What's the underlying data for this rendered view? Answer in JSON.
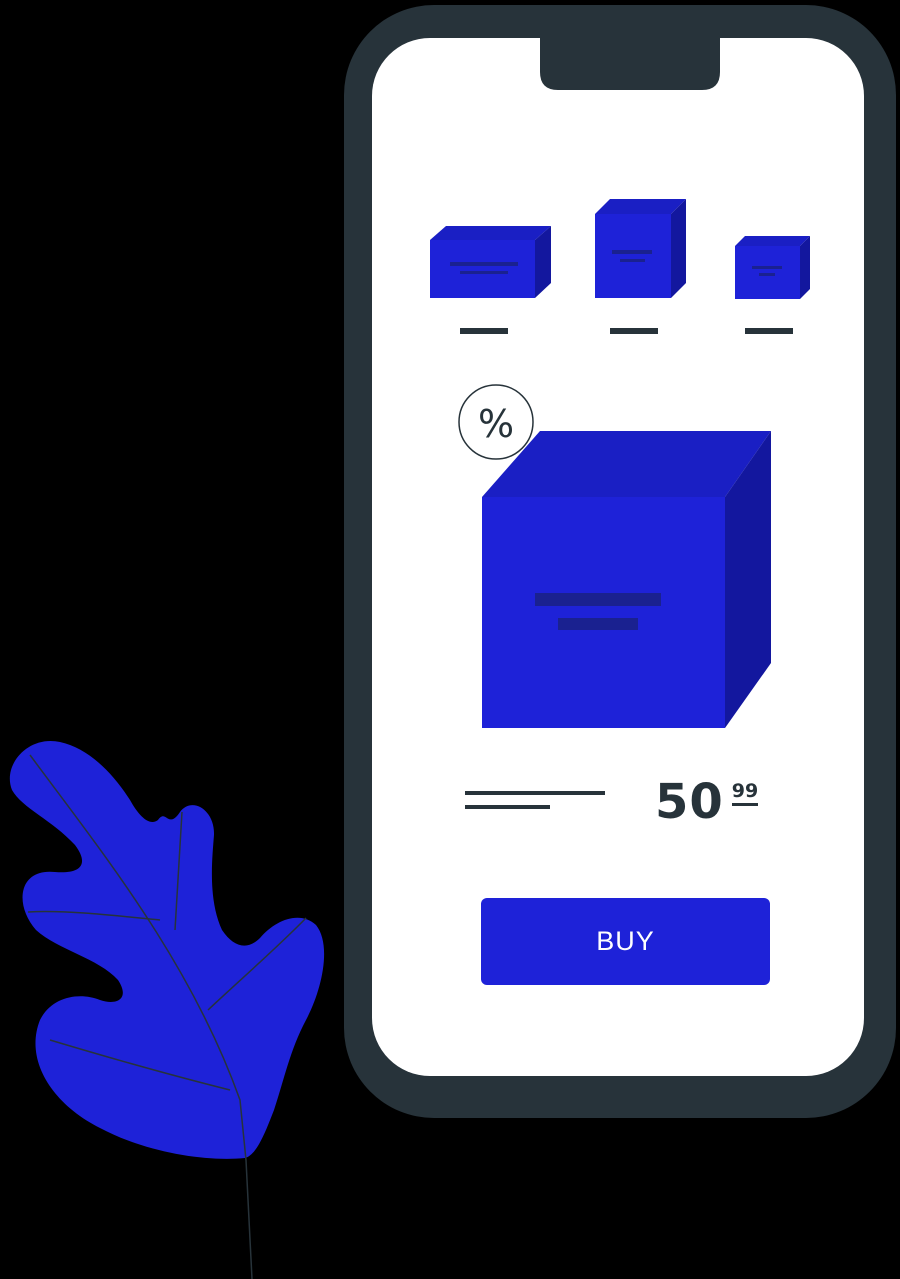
{
  "product": {
    "discount_symbol": "%",
    "price_main": "50",
    "price_cents": "99",
    "buy_label": "BUY"
  },
  "colors": {
    "background": "#000000",
    "phone_frame": "#27333a",
    "screen": "#ffffff",
    "accent_blue": "#1e22d8",
    "accent_blue_dark": "#13179e",
    "leaf": "#1e22d8"
  },
  "icons": [
    "box-icon",
    "percent-badge-icon",
    "leaf-icon"
  ]
}
